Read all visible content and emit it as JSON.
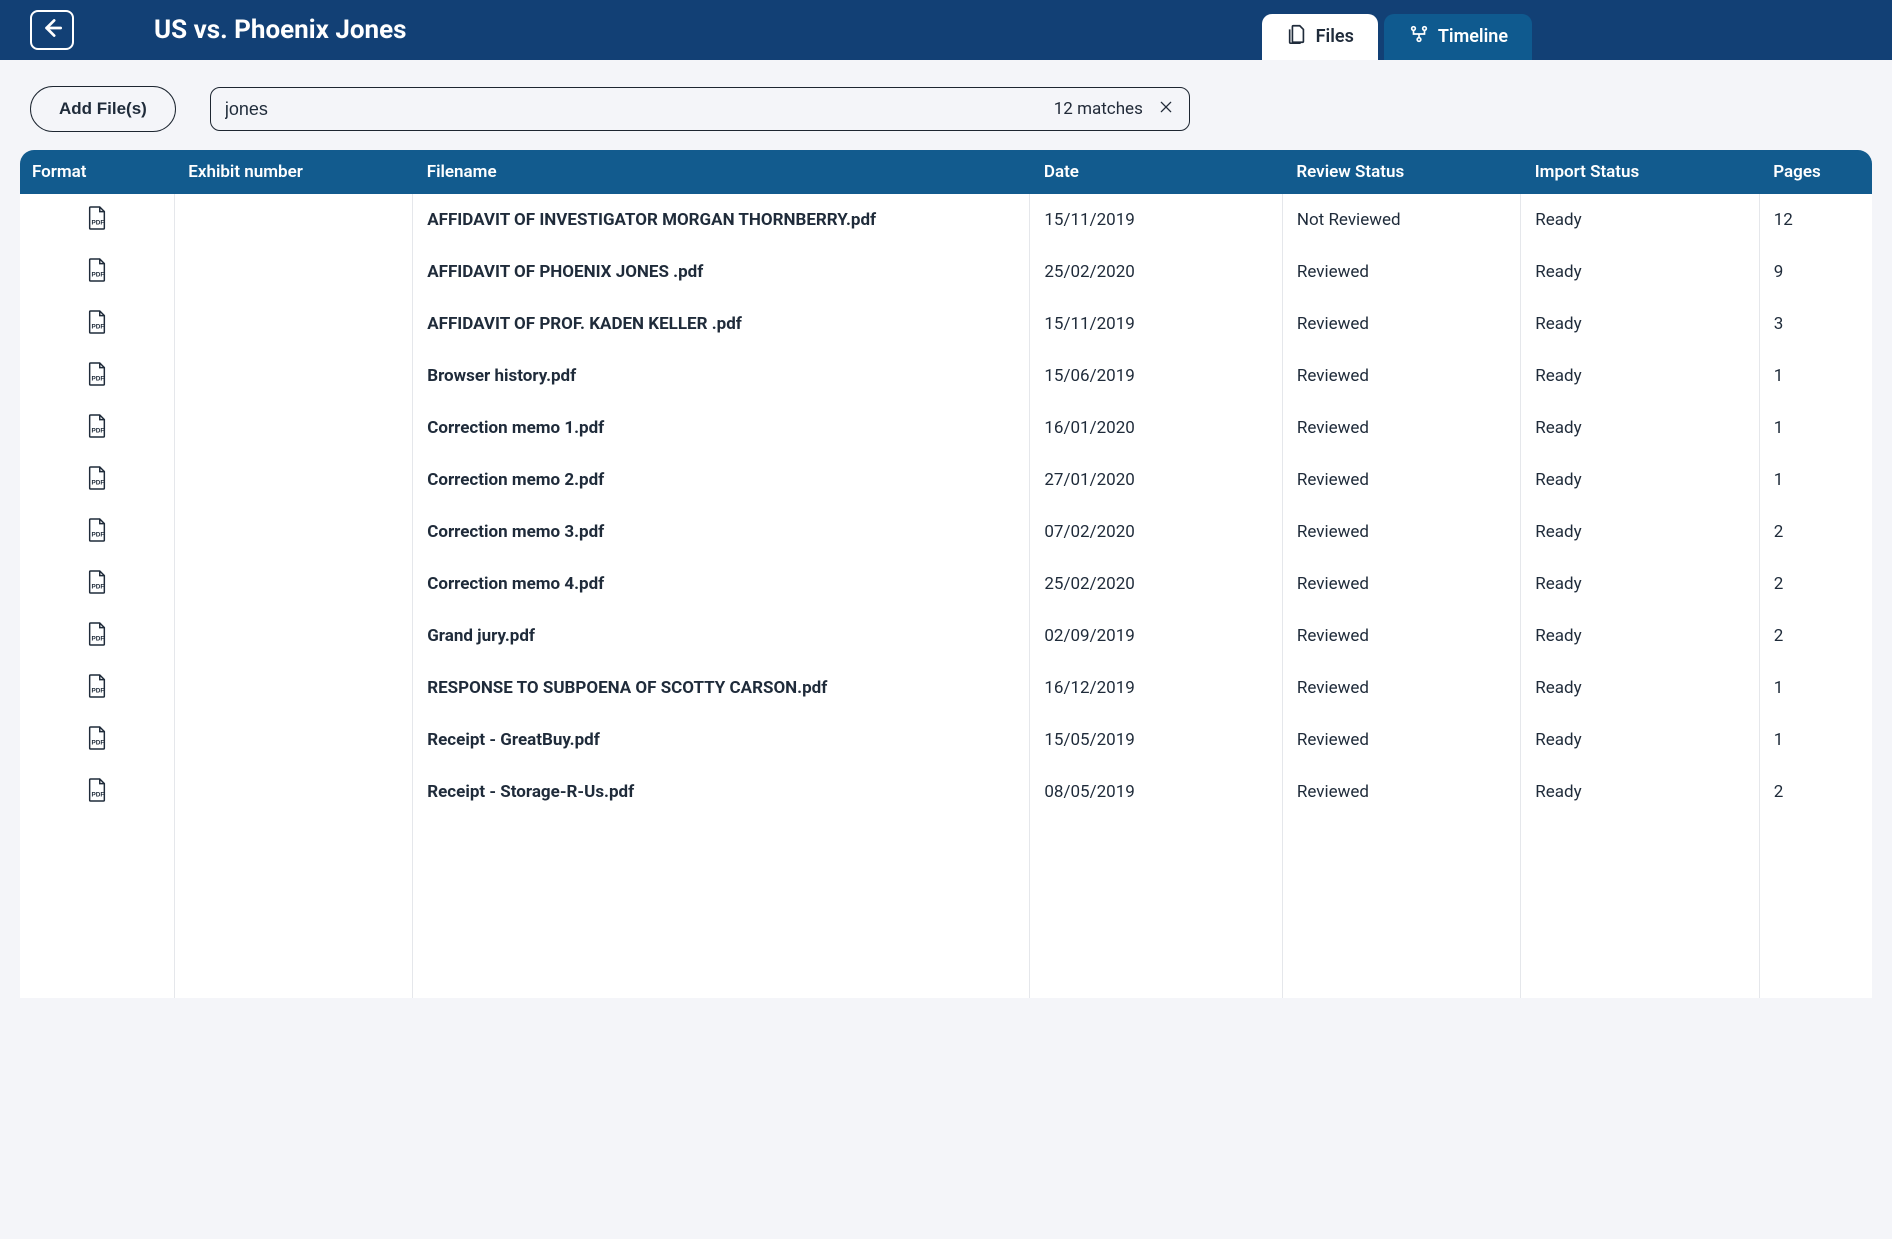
{
  "header": {
    "title": "US vs. Phoenix Jones",
    "tabs": {
      "files": "Files",
      "timeline": "Timeline"
    }
  },
  "toolbar": {
    "add_files_label": "Add File(s)",
    "search_value": "jones",
    "search_matches": "12 matches"
  },
  "table": {
    "columns": {
      "format": "Format",
      "exhibit": "Exhibit number",
      "filename": "Filename",
      "date": "Date",
      "review": "Review Status",
      "import": "Import Status",
      "pages": "Pages"
    },
    "rows": [
      {
        "exhibit": "",
        "filename": "AFFIDAVIT OF INVESTIGATOR MORGAN THORNBERRY.pdf",
        "date": "15/11/2019",
        "review": "Not Reviewed",
        "import": "Ready",
        "pages": "12"
      },
      {
        "exhibit": "",
        "filename": "AFFIDAVIT OF PHOENIX JONES .pdf",
        "date": "25/02/2020",
        "review": "Reviewed",
        "import": "Ready",
        "pages": "9"
      },
      {
        "exhibit": "",
        "filename": "AFFIDAVIT OF PROF. KADEN KELLER .pdf",
        "date": "15/11/2019",
        "review": "Reviewed",
        "import": "Ready",
        "pages": "3"
      },
      {
        "exhibit": "",
        "filename": "Browser history.pdf",
        "date": "15/06/2019",
        "review": "Reviewed",
        "import": "Ready",
        "pages": "1"
      },
      {
        "exhibit": "",
        "filename": "Correction memo 1.pdf",
        "date": "16/01/2020",
        "review": "Reviewed",
        "import": "Ready",
        "pages": "1"
      },
      {
        "exhibit": "",
        "filename": "Correction memo 2.pdf",
        "date": "27/01/2020",
        "review": "Reviewed",
        "import": "Ready",
        "pages": "1"
      },
      {
        "exhibit": "",
        "filename": "Correction memo 3.pdf",
        "date": "07/02/2020",
        "review": "Reviewed",
        "import": "Ready",
        "pages": "2"
      },
      {
        "exhibit": "",
        "filename": "Correction memo 4.pdf",
        "date": "25/02/2020",
        "review": "Reviewed",
        "import": "Ready",
        "pages": "2"
      },
      {
        "exhibit": "",
        "filename": "Grand jury.pdf",
        "date": "02/09/2019",
        "review": "Reviewed",
        "import": "Ready",
        "pages": "2"
      },
      {
        "exhibit": "",
        "filename": "RESPONSE TO SUBPOENA OF SCOTTY CARSON.pdf",
        "date": "16/12/2019",
        "review": "Reviewed",
        "import": "Ready",
        "pages": "1"
      },
      {
        "exhibit": "",
        "filename": "Receipt - GreatBuy.pdf",
        "date": "15/05/2019",
        "review": "Reviewed",
        "import": "Ready",
        "pages": "1"
      },
      {
        "exhibit": "",
        "filename": "Receipt - Storage-R-Us.pdf",
        "date": "08/05/2019",
        "review": "Reviewed",
        "import": "Ready",
        "pages": "2"
      }
    ]
  }
}
